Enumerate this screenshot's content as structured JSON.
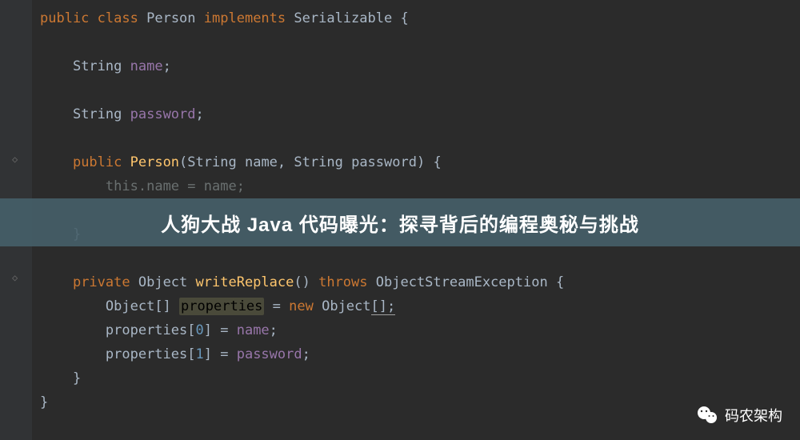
{
  "code": {
    "line1": {
      "kw1": "public",
      "kw2": "class",
      "name": "Person",
      "kw3": "implements",
      "iface": "Serializable",
      "brace": "{"
    },
    "line3": {
      "type": "String",
      "field": "name",
      "semi": ";"
    },
    "line5": {
      "type": "String",
      "field": "password",
      "semi": ";"
    },
    "line7": {
      "kw": "public",
      "ctor": "Person",
      "p1type": "String",
      "p1": "name",
      "p2type": "String",
      "p2": "password",
      "tail": ") {"
    },
    "line8": {
      "thisref": "this",
      "dot": ".",
      "field": "name",
      "eq": " = ",
      "val": "name",
      "semi": ";"
    },
    "line10": {
      "brace": "}"
    },
    "line12": {
      "kw1": "private",
      "type": "Object",
      "method": "writeReplace",
      "paren": "()",
      "kw2": "throws",
      "exc": "ObjectStreamException",
      "brace": "{"
    },
    "line13": {
      "type": "Object",
      "brackets": "[]",
      "var": "properties",
      "eq": " = ",
      "kw": "new",
      "type2": "Object",
      "brackets2": "[]",
      "semi": ";"
    },
    "line14": {
      "var": "properties",
      "idx_open": "[",
      "num": "0",
      "idx_close": "]",
      "eq": " = ",
      "val": "name",
      "semi": ";"
    },
    "line15": {
      "var": "properties",
      "idx_open": "[",
      "num": "1",
      "idx_close": "]",
      "eq": " = ",
      "val": "password",
      "semi": ";"
    },
    "line16": {
      "brace": "}"
    },
    "line17": {
      "brace": "}"
    }
  },
  "banner": {
    "text": "人狗大战 Java 代码曝光：探寻背后的编程奥秘与挑战"
  },
  "watermark": {
    "text": "码农架构"
  }
}
